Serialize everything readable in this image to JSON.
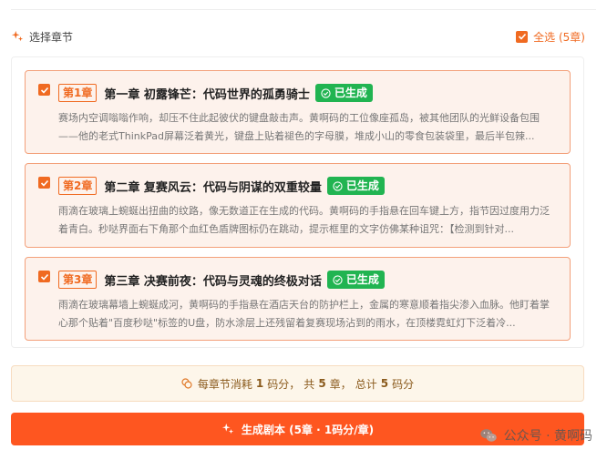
{
  "header": {
    "title": "选择章节",
    "select_all_label": "全选 (5章)"
  },
  "chapters": [
    {
      "badge": "第1章",
      "title": "第一章 初露锋芒：代码世界的孤勇骑士",
      "status": "已生成",
      "summary": "赛场内空调嗡嗡作响，却压不住此起彼伏的键盘敲击声。黄啊码的工位像座孤岛，被其他团队的光鲜设备包围——他的老式ThinkPad屏幕泛着黄光，键盘上贴着褪色的字母膜，堆成小山的零食包装袋里，最后半包辣..."
    },
    {
      "badge": "第2章",
      "title": "第二章 复赛风云：代码与阴谋的双重较量",
      "status": "已生成",
      "summary": "雨滴在玻璃上蜿蜒出扭曲的纹路，像无数道正在生成的代码。黄啊码的手指悬在回车键上方，指节因过度用力泛着青白。秒哒界面右下角那个血红色盾牌图标仍在跳动，提示框里的文字仿佛某种诅咒：【检测到针对..."
    },
    {
      "badge": "第3章",
      "title": "第三章 决赛前夜：代码与灵魂的终极对话",
      "status": "已生成",
      "summary": "雨滴在玻璃幕墙上蜿蜒成河，黄啊码的手指悬在酒店天台的防护栏上，金属的寒意顺着指尖渗入血脉。他盯着掌心那个贴着\"百度秒哒\"标签的U盘，防水涂层上还残留着复赛现场沾到的雨水，在顶楼霓虹灯下泛着冷..."
    }
  ],
  "cost": {
    "prefix": "每章节消耗",
    "per_chapter": "1",
    "unit1": "码分，",
    "total_prefix": "共",
    "chapter_count": "5",
    "chapter_unit": "章，",
    "sum_prefix": "总计",
    "total": "5",
    "unit2": "码分"
  },
  "generate_button_label": "生成剧本 (5章 · 1码分/章)",
  "watermark": "公众号 · 黄啊码",
  "colors": {
    "accent": "#f06a21",
    "button": "#fe5620",
    "success": "#21b451",
    "card_bg": "#fdf2ec",
    "cost_bg": "#fdf6ea"
  },
  "icons": {
    "header": "sparkle-icon",
    "checkbox": "check-icon",
    "status": "check-circle-icon",
    "cost": "coin-icon",
    "button": "sparkle-icon",
    "watermark": "wechat-icon"
  }
}
